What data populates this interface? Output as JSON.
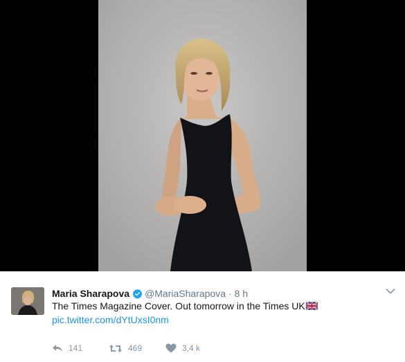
{
  "tweet": {
    "fullname": "Maria Sharapova",
    "handle": "@MariaSharapova",
    "separator": "·",
    "time": "8 h",
    "text": "The Times Magazine Cover. Out tomorrow in the Times UK",
    "flag_icon": "uk-flag-icon",
    "link": "pic.twitter.com/dYtUxsI0nm",
    "actions": {
      "reply_count": "141",
      "retweet_count": "469",
      "like_count": "3,4 k"
    }
  },
  "colors": {
    "link": "#1b95e0",
    "muted": "#657786",
    "action": "#8899a6",
    "verified": "#1da1f2"
  }
}
